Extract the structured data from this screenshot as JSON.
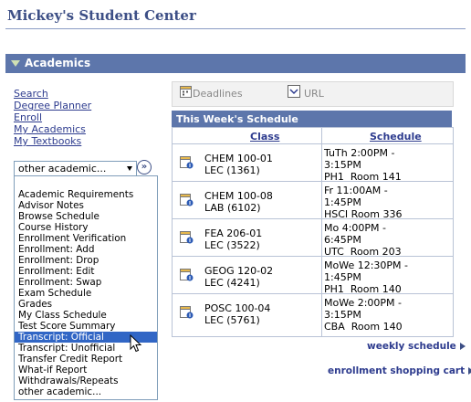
{
  "page_title": "Mickey's Student Center",
  "section": {
    "title": "Academics"
  },
  "left_links": [
    "Search",
    "Degree Planner",
    "Enroll",
    "My Academics",
    "My Textbooks"
  ],
  "other_select": {
    "selected": "other academic...",
    "go_icon": "double-chevron-right-icon"
  },
  "dropdown_options": [
    "Academic Requirements",
    "Advisor Notes",
    "Browse Schedule",
    "Course History",
    "Enrollment Verification",
    "Enrollment: Add",
    "Enrollment: Drop",
    "Enrollment: Edit",
    "Enrollment: Swap",
    "Exam Schedule",
    "Grades",
    "My Class Schedule",
    "Test Score Summary",
    "Transcript: Official",
    "Transcript: Unofficial",
    "Transfer Credit Report",
    "What-if Report",
    "Withdrawals/Repeats",
    "other academic..."
  ],
  "dropdown_selected_index": 13,
  "tabs": [
    {
      "label": "Deadlines",
      "icon": "calendar-icon"
    },
    {
      "label": "URL",
      "icon": "url-icon"
    }
  ],
  "schedule": {
    "title": "This Week's Schedule",
    "col_class": "Class",
    "col_schedule": "Schedule",
    "rows": [
      {
        "class1": "CHEM 100-01",
        "class2": "LEC (1361)",
        "s1": "TuTh 2:00PM -",
        "s2": "3:15PM",
        "s3": "PH1  Room 141"
      },
      {
        "class1": "CHEM 100-08",
        "class2": "LAB (6102)",
        "s1": "Fr 11:00AM -",
        "s2": "1:45PM",
        "s3": "HSCI Room 336"
      },
      {
        "class1": "FEA 206-01",
        "class2": "LEC (3522)",
        "s1": "Mo 4:00PM -",
        "s2": "6:45PM",
        "s3": "UTC  Room 203"
      },
      {
        "class1": "GEOG 120-02",
        "class2": "LEC (4241)",
        "s1": "MoWe 12:30PM -",
        "s2": "1:45PM",
        "s3": "PH1  Room 140"
      },
      {
        "class1": "POSC 100-04",
        "class2": "LEC (5761)",
        "s1": "MoWe 2:00PM -",
        "s2": "3:15PM",
        "s3": "CBA  Room 140"
      }
    ]
  },
  "weekly_schedule_link": "weekly schedule",
  "shopping_cart_link": "enrollment shopping cart",
  "colors": {
    "header_bg": "#5d76ab",
    "link": "#2d3b8e",
    "selected": "#3166c5"
  }
}
